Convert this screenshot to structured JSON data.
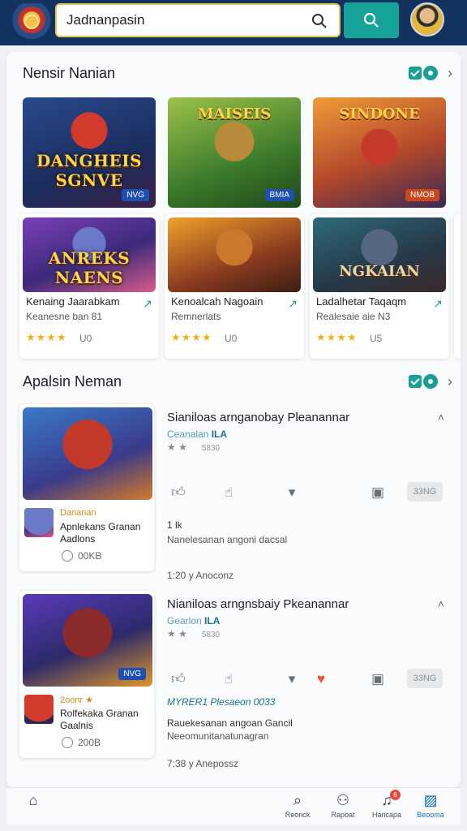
{
  "search": {
    "value": "Jadnanpasin",
    "placeholder": ""
  },
  "section1": {
    "title": "Nensir Nanian",
    "thumbs": [
      {
        "caption": "DANGHEIS SGNVE",
        "tag": "NVG"
      },
      {
        "caption": "MAISEIS",
        "tag": "BMIA"
      },
      {
        "caption": "SINDONE",
        "tag": "NMOB"
      }
    ],
    "cards": [
      {
        "caption": "ANREKS NAENS",
        "name": "Kenaing Jaarabkam",
        "sub": "Keanesne ban 81",
        "stars": "★★★★",
        "count": "U0"
      },
      {
        "caption": "",
        "name": "Kenoalcah Nagoain",
        "sub": "Remnerlats",
        "stars": "★★★★",
        "count": "U0"
      },
      {
        "caption": "NGKAIAN",
        "name": "Ladalhetar Taqaqm",
        "sub": "Realesaie aie N3",
        "stars": "★★★★",
        "count": "U5"
      }
    ]
  },
  "section2": {
    "title": "Apalsin Neman",
    "items": [
      {
        "title": "Sianiloas arnganobay Pleanannar",
        "meta_a": "Ceanalan",
        "meta_b": "ILA",
        "stars": "★ ★",
        "stars_n": "5830",
        "pill": "33NG",
        "line1": "1 lk",
        "line2": "Nanelesanan angoni dacsal",
        "time": "1:20 y Anoconz",
        "mini_label": "Dananan",
        "mini_name": "Apnlekans Granan Aadlons",
        "download": "00KB"
      },
      {
        "title": "Nianiloas arngnsbaiy Pkeanannar",
        "meta_a": "Gearlon",
        "meta_b": "ILA",
        "stars": "★ ★",
        "stars_n": "5830",
        "pill": "33NG",
        "line0": "MYRER1 Plesaeon 0033",
        "line1": "Rauekesanan angoan Gancil",
        "line2": "Neeomunitanatunagran",
        "time": "7:38 y Anepossz",
        "mini_label": "2oonr ★",
        "mini_name": "Rolfekaka Granan Gaalnis",
        "download": "200B"
      }
    ]
  },
  "bottomnav": [
    {
      "label": ""
    },
    {
      "label": "Reonck"
    },
    {
      "label": "Rapoat"
    },
    {
      "label": "Hancapa",
      "badge": "6"
    },
    {
      "label": "Beooma"
    }
  ],
  "colors": {
    "topbar": "#12325f",
    "accent": "#16a39a",
    "star": "#f0b21a"
  }
}
